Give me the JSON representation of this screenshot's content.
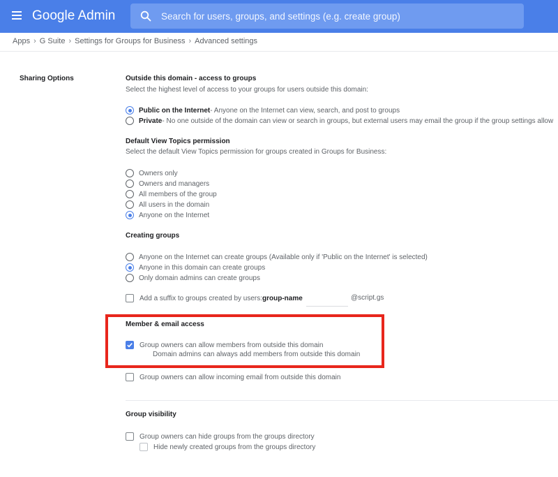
{
  "header": {
    "logo": "Google Admin",
    "search_placeholder": "Search for users, groups, and settings (e.g. create group)"
  },
  "breadcrumb": [
    "Apps",
    "G Suite",
    "Settings for Groups for Business",
    "Advanced settings"
  ],
  "section_label": "Sharing Options",
  "outside": {
    "heading": "Outside this domain - access to groups",
    "desc": "Select the highest level of access to your groups for users outside this domain:",
    "public_title": "Public on the Internet",
    "public_desc": " - Anyone on the Internet can view, search, and post to groups",
    "private_title": "Private",
    "private_desc": " - No one outside of the domain can view or search in groups, but external users may email the group if the group settings allow"
  },
  "view_topics": {
    "heading": "Default View Topics permission",
    "desc": "Select the default View Topics permission for groups created in Groups for Business:",
    "options": [
      "Owners only",
      "Owners and managers",
      "All members of the group",
      "All users in the domain",
      "Anyone on the Internet"
    ]
  },
  "creating": {
    "heading": "Creating groups",
    "options": [
      "Anyone on the Internet can create groups (Available only if 'Public on the Internet' is selected)",
      "Anyone in this domain can create groups",
      "Only domain admins can create groups"
    ],
    "suffix_label": "Add a suffix to groups created by users: ",
    "suffix_name": "group-name",
    "suffix_domain": "@script.gs"
  },
  "member": {
    "heading": "Member & email access",
    "allow_outside": "Group owners can allow members from outside this domain",
    "admin_note": "Domain admins can always add members from outside this domain",
    "allow_email": "Group owners can allow incoming email from outside this domain"
  },
  "visibility": {
    "heading": "Group visibility",
    "hide_groups": "Group owners can hide groups from the groups directory",
    "hide_new": "Hide newly created groups from the groups directory"
  },
  "colors": {
    "header_bg": "#4a7fe8",
    "highlight_border": "#e8261c",
    "accent": "#4a7fe8"
  }
}
